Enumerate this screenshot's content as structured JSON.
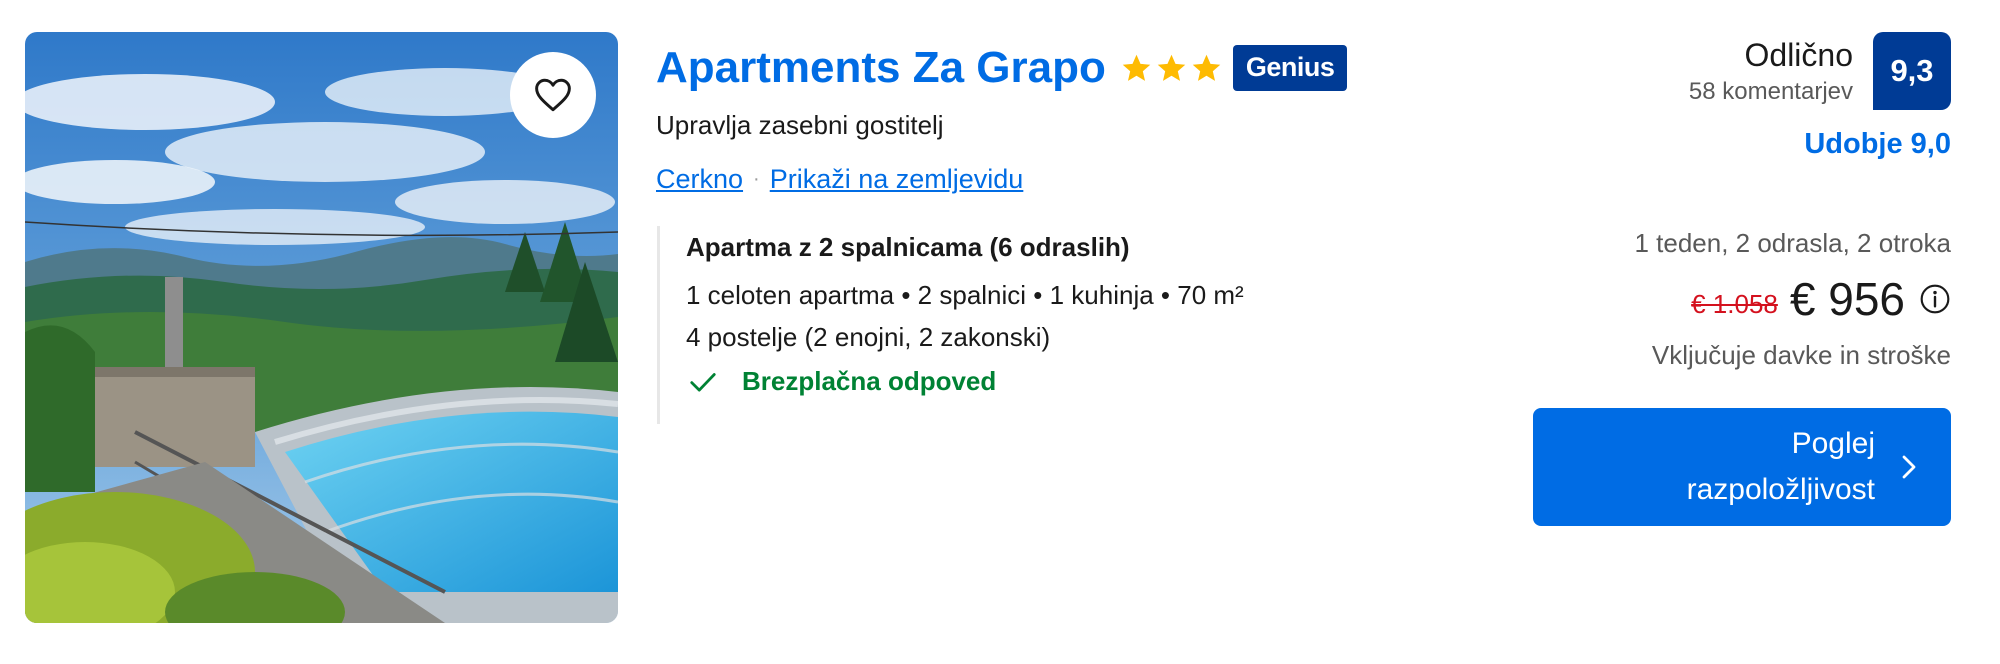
{
  "property": {
    "title": "Apartments Za Grapo",
    "star_count": 3,
    "genius_badge": "Genius",
    "host": "Upravlja zasebni gostitelj",
    "location": "Cerkno",
    "map_link": "Prikaži na zemljevidu",
    "separator": "·"
  },
  "room": {
    "name": "Apartma z 2 spalnicama (6 odraslih)",
    "details": "1 celoten apartma • 2 spalnici • 1 kuhinja • 70 m²",
    "beds": "4 postelje (2 enojni, 2 zakonski)",
    "free_cancellation": "Brezplačna odpoved"
  },
  "review": {
    "word": "Odlično",
    "count": "58 komentarjev",
    "score": "9,3",
    "comfort": "Udobje 9,0"
  },
  "pricing": {
    "stay": "1 teden, 2 odrasla, 2 otroka",
    "old_price": "€ 1.058",
    "new_price": "€ 956",
    "taxes": "Vključuje davke in stroške"
  },
  "cta": {
    "line1": "Poglej",
    "line2": "razpoložljivost"
  },
  "icons": {
    "favorite": "heart-icon",
    "star": "star-icon",
    "check": "check-icon",
    "info": "info-icon",
    "chevron": "chevron-right-icon"
  },
  "colors": {
    "link_blue": "#006ce4",
    "dark_blue": "#003b95",
    "star_yellow": "#febb02",
    "green": "#008234",
    "strike_red": "#d4111e"
  }
}
